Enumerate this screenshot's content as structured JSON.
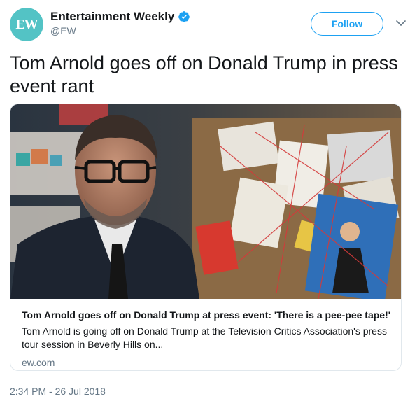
{
  "header": {
    "avatar_text": "EW",
    "display_name": "Entertainment Weekly",
    "handle": "@EW",
    "follow_label": "Follow",
    "verified_icon": "verified-badge-icon",
    "menu_icon": "chevron-down-icon"
  },
  "tweet": {
    "text": "Tom Arnold goes off on Donald Trump in press event rant",
    "timestamp": "2:34 PM - 26 Jul 2018"
  },
  "card": {
    "title": "Tom Arnold goes off on Donald Trump at press event: 'There is a pee-pee tape!'",
    "description": "Tom Arnold is going off on Donald Trump at the Television Critics Association's press tour session in Beverly Hills on...",
    "domain": "ew.com"
  },
  "colors": {
    "accent": "#1da1f2",
    "avatar_bg": "#53c3c5",
    "text_primary": "#14171a",
    "text_secondary": "#657786",
    "border": "#e1e8ed"
  }
}
